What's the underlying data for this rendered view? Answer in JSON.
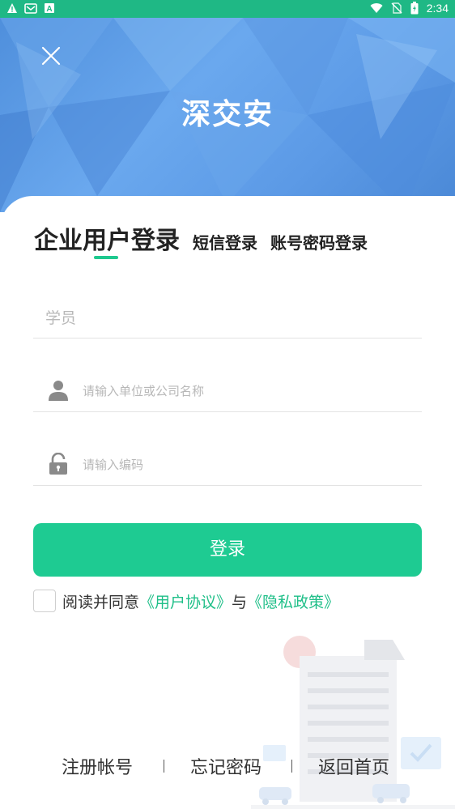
{
  "status_bar": {
    "left_icons": [
      "warning-icon",
      "mail-icon",
      "text-a-icon"
    ],
    "right_icons": [
      "wifi-icon",
      "no-sim-icon",
      "battery-charging-icon"
    ],
    "time": "2:34"
  },
  "header": {
    "app_title": "深交安",
    "close_icon": "close-icon"
  },
  "tabs": {
    "active": "企业用户登录",
    "sms": "短信登录",
    "password": "账号密码登录"
  },
  "form": {
    "role_placeholder": "学员",
    "company_placeholder": "请输入单位或公司名称",
    "code_placeholder": "请输入编码"
  },
  "login_label": "登录",
  "agreement": {
    "prefix": "阅读并同意",
    "user_agreement": "《用户协议》",
    "conjunction": "与",
    "privacy_policy": "《隐私政策》"
  },
  "footer": {
    "register": "注册帐号",
    "forgot": "忘记密码",
    "home": "返回首页"
  },
  "colors": {
    "status_bar": "#1fb885",
    "accent": "#1ecb92",
    "link": "#1fbf88",
    "hero": "#5c9ae6"
  }
}
